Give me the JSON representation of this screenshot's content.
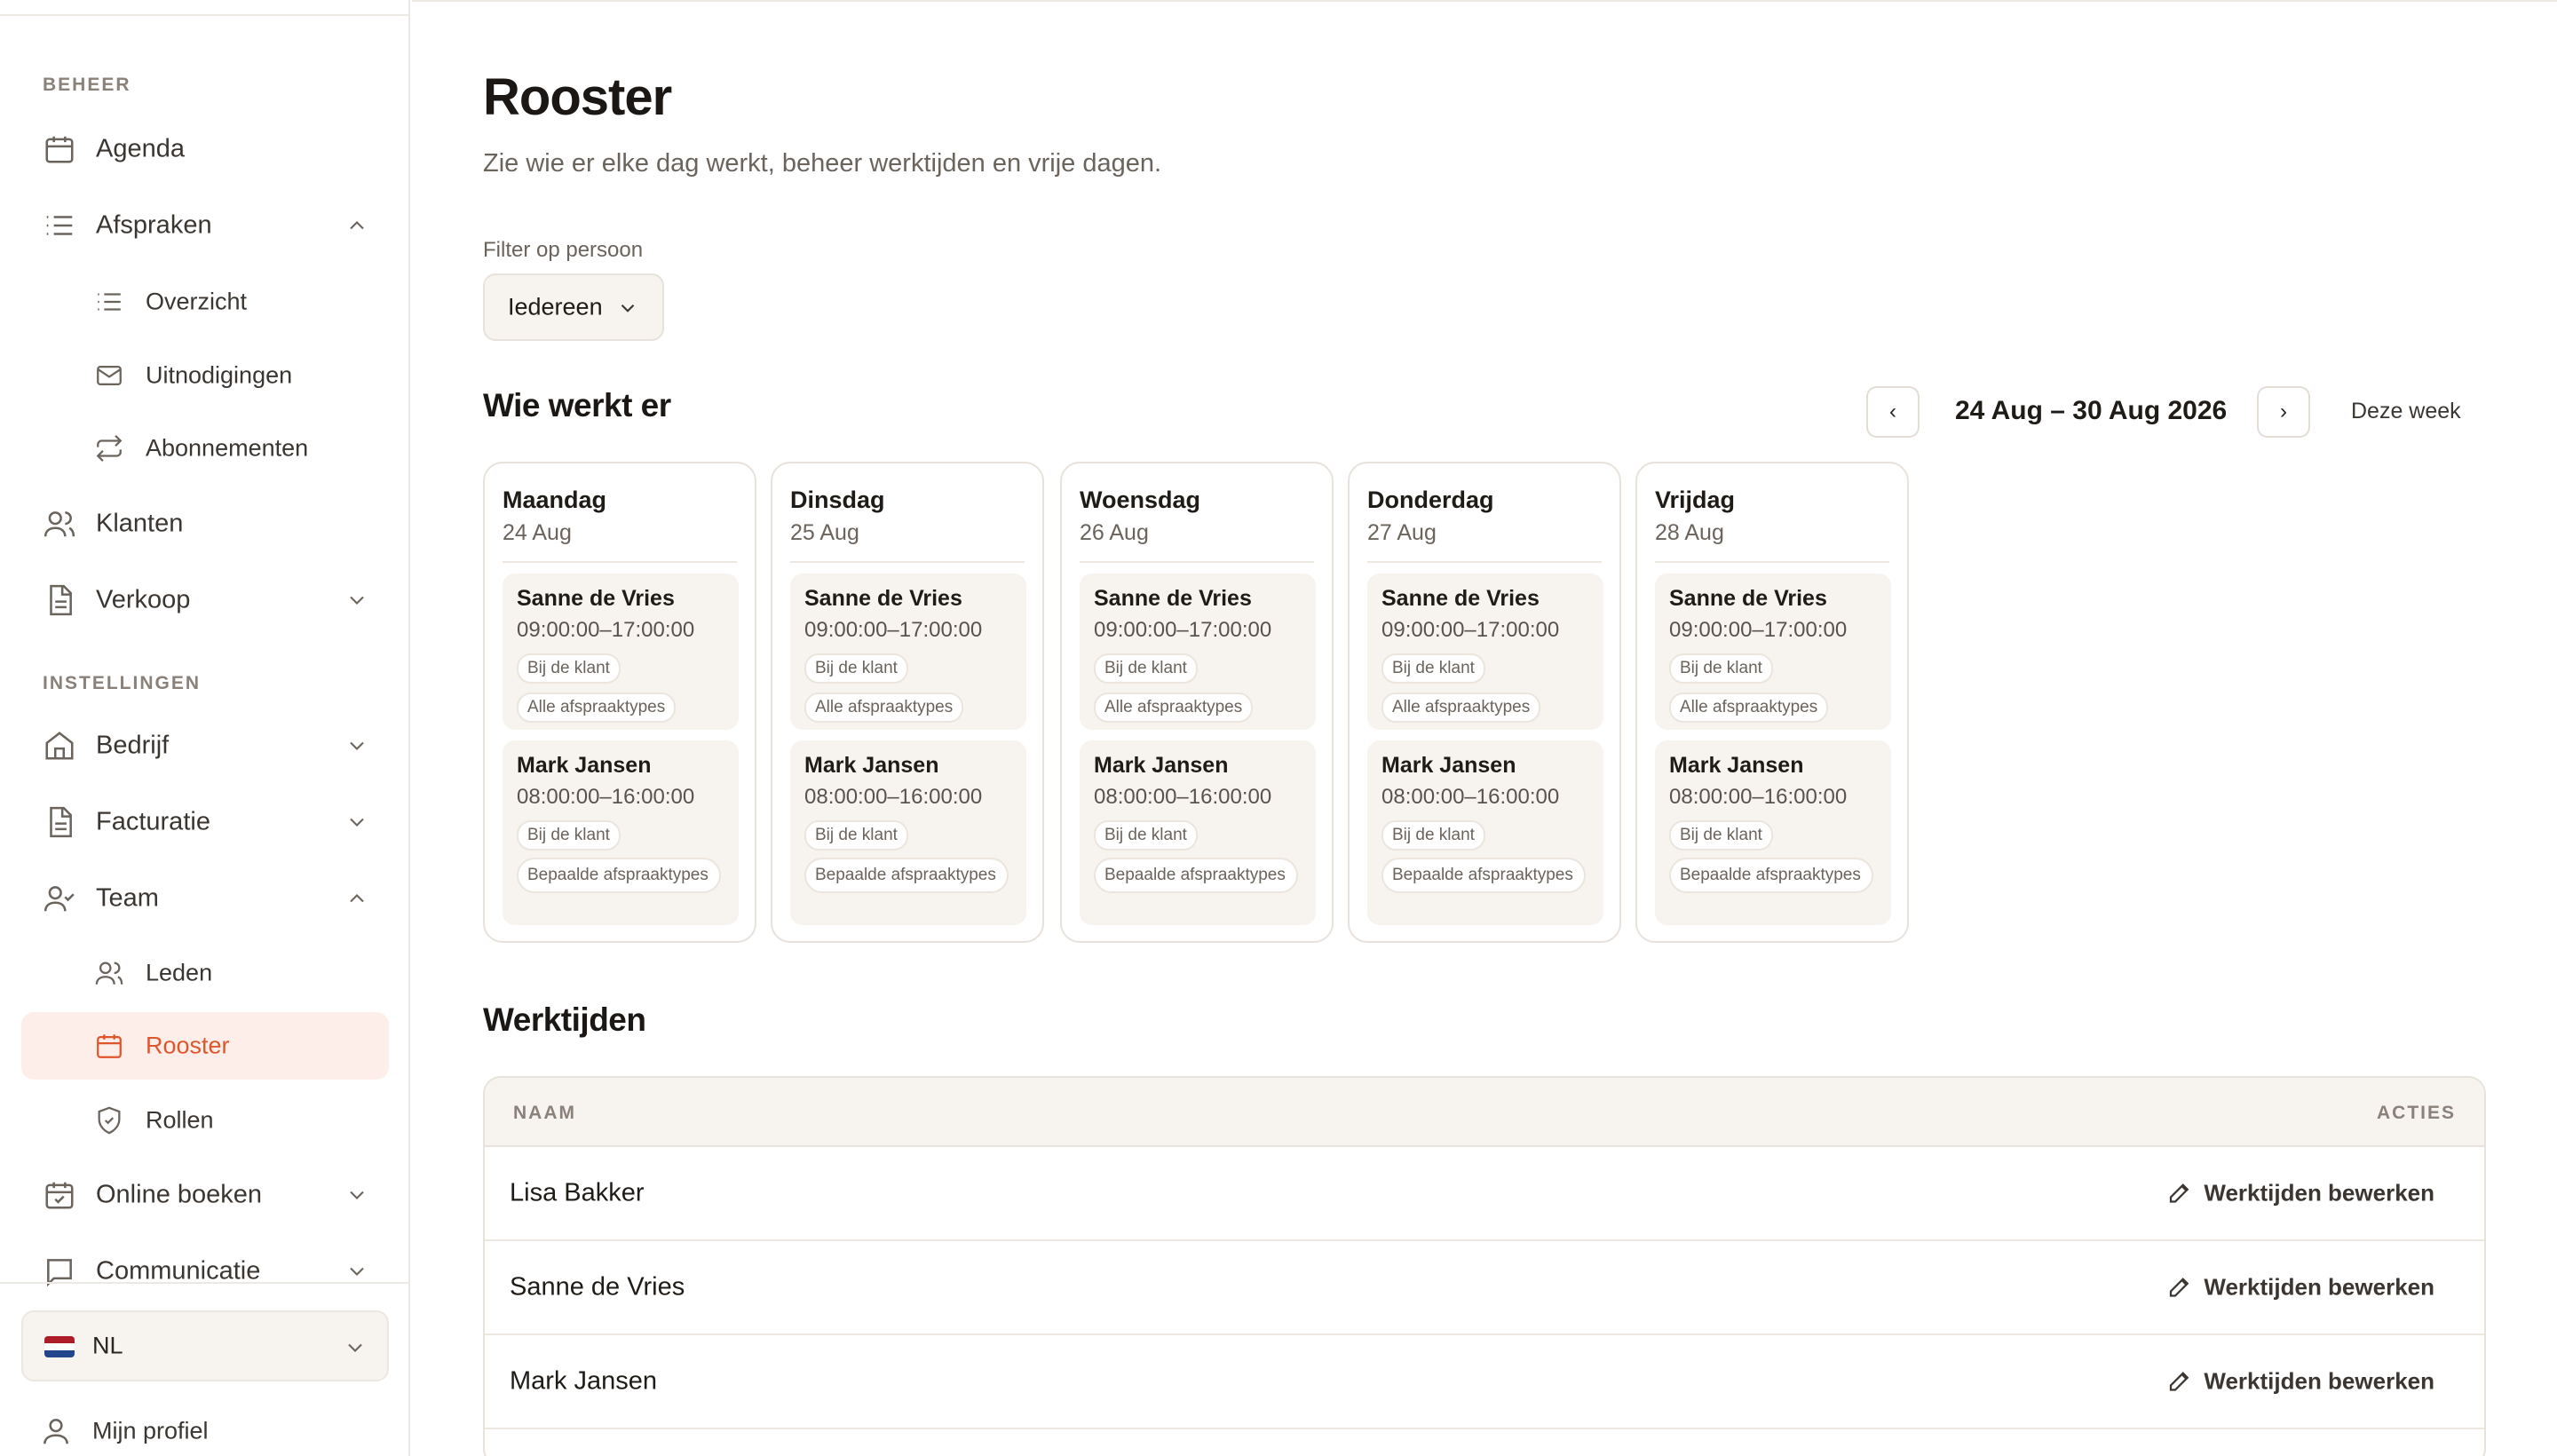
{
  "sidebar": {
    "section_beheer": "BEHEER",
    "section_instellingen": "INSTELLINGEN",
    "items": {
      "agenda": "Agenda",
      "afspraken": "Afspraken",
      "overzicht": "Overzicht",
      "uitnodigingen": "Uitnodigingen",
      "abonnementen": "Abonnementen",
      "klanten": "Klanten",
      "verkoop": "Verkoop",
      "bedrijf": "Bedrijf",
      "facturatie": "Facturatie",
      "team": "Team",
      "leden": "Leden",
      "rooster": "Rooster",
      "rollen": "Rollen",
      "online_boeken": "Online boeken",
      "communicatie": "Communicatie"
    },
    "language": "NL",
    "profile": "Mijn profiel"
  },
  "colors": {
    "accent": "#e0562c",
    "active_bg": "#fdeee9",
    "card_bg": "#f7f3ee"
  },
  "page": {
    "title": "Rooster",
    "subtitle": "Zie wie er elke dag werkt, beheer werktijden en vrije dagen.",
    "filter_label": "Filter op persoon",
    "filter_value": "Iedereen"
  },
  "schedule": {
    "title": "Wie werkt er",
    "prev": "‹",
    "next": "›",
    "range": "24 Aug – 30 Aug 2026",
    "this_week": "Deze week",
    "days": [
      {
        "name": "Maandag",
        "date": "24 Aug"
      },
      {
        "name": "Dinsdag",
        "date": "25 Aug"
      },
      {
        "name": "Woensdag",
        "date": "26 Aug"
      },
      {
        "name": "Donderdag",
        "date": "27 Aug"
      },
      {
        "name": "Vrijdag",
        "date": "28 Aug"
      }
    ],
    "shifts": [
      {
        "person": "Sanne de Vries",
        "time": "09:00:00–17:00:00",
        "location": "Bij de klant",
        "types": "Alle afspraaktypes"
      },
      {
        "person": "Mark Jansen",
        "time": "08:00:00–16:00:00",
        "location": "Bij de klant",
        "types": "Bepaalde afspraaktypes"
      }
    ]
  },
  "hours": {
    "title": "Werktijden",
    "col_name": "NAAM",
    "col_actions": "ACTIES",
    "action_label": "Werktijden bewerken",
    "rows": [
      "Lisa Bakker",
      "Sanne de Vries",
      "Mark Jansen"
    ]
  }
}
